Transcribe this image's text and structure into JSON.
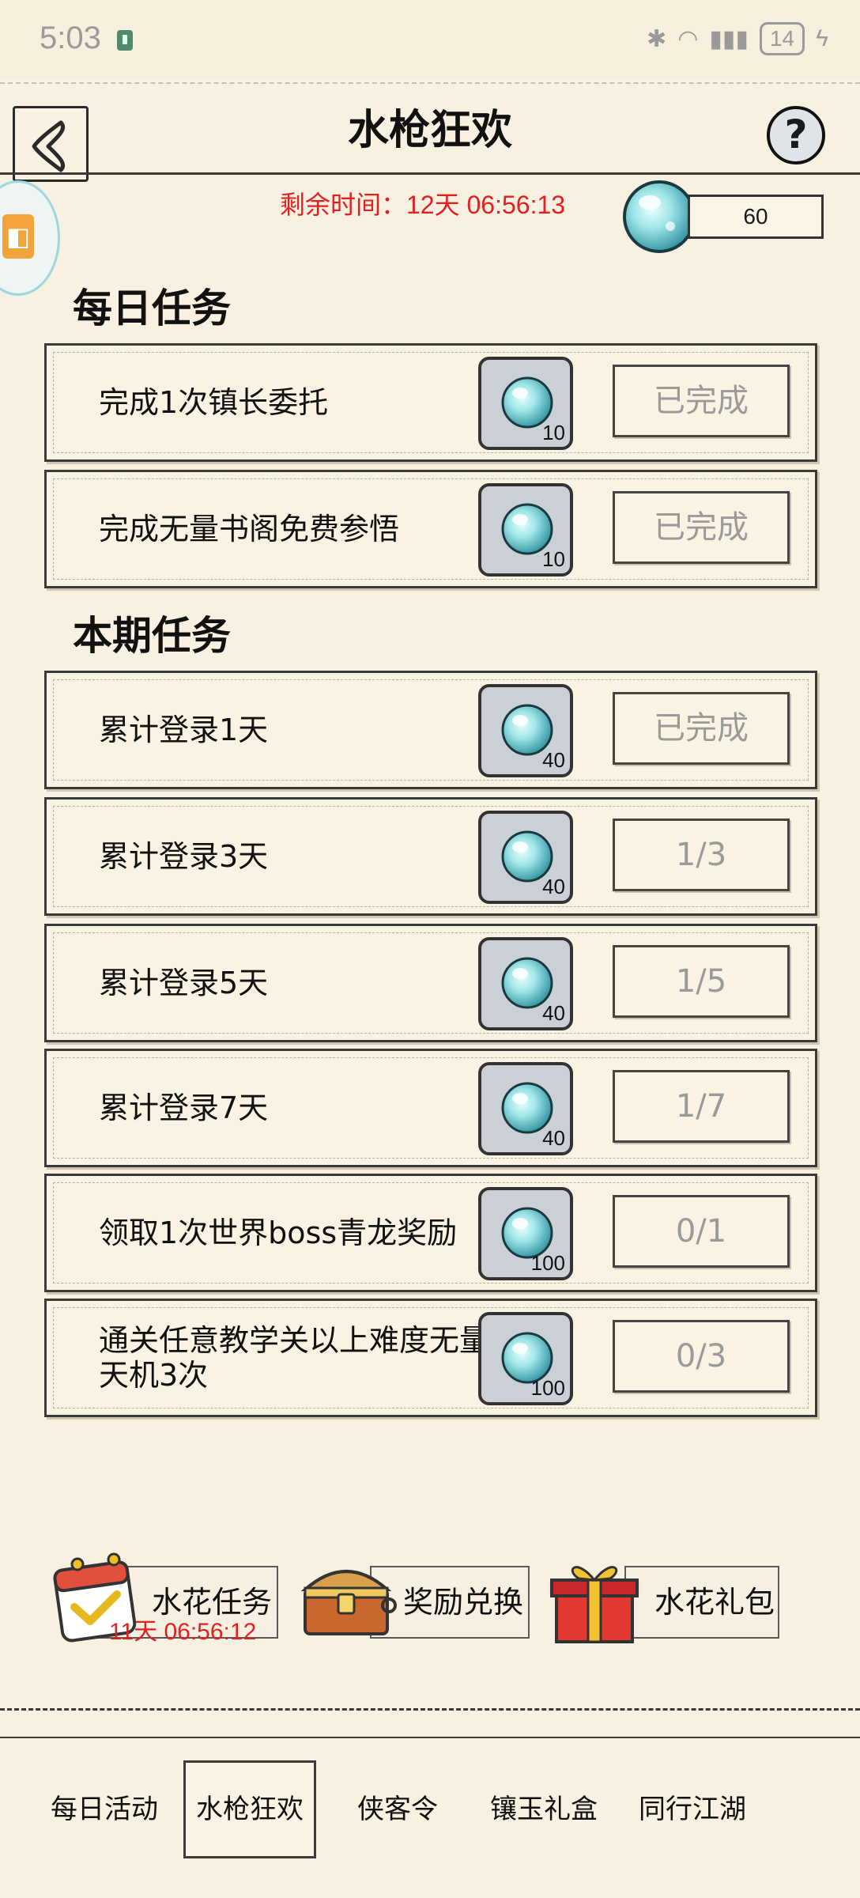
{
  "status_bar": {
    "time": "5:03",
    "battery": "14"
  },
  "header": {
    "title": "水枪狂欢",
    "help_label": "?"
  },
  "event": {
    "timer_text": "剩余时间：12天 06:56:13",
    "currency_count": "60"
  },
  "sections": {
    "daily_title": "每日任务",
    "period_title": "本期任务"
  },
  "daily_tasks": [
    {
      "label": "完成1次镇长委托",
      "reward": "10",
      "status": "已完成"
    },
    {
      "label": "完成无量书阁免费参悟",
      "reward": "10",
      "status": "已完成"
    }
  ],
  "period_tasks": [
    {
      "label": "累计登录1天",
      "reward": "40",
      "status": "已完成"
    },
    {
      "label": "累计登录3天",
      "reward": "40",
      "status": "1/3"
    },
    {
      "label": "累计登录5天",
      "reward": "40",
      "status": "1/5"
    },
    {
      "label": "累计登录7天",
      "reward": "40",
      "status": "1/7"
    },
    {
      "label": "领取1次世界boss青龙奖励",
      "reward": "100",
      "status": "0/1"
    },
    {
      "label": "通关任意教学关以上难度无量天机3次",
      "reward": "100",
      "status": "0/3"
    }
  ],
  "bottom_buttons": {
    "splash_tasks": "水花任务",
    "splash_tasks_timer": "11天 06:56:12",
    "reward_exchange": "奖励兑换",
    "splash_gift": "水花礼包"
  },
  "tabs": [
    "每日活动",
    "水枪狂欢",
    "侠客令",
    "镶玉礼盒",
    "同行江湖"
  ],
  "colors": {
    "background": "#f8f0e0",
    "timer_red": "#e12020",
    "orb_cyan": "#8fdde0"
  }
}
